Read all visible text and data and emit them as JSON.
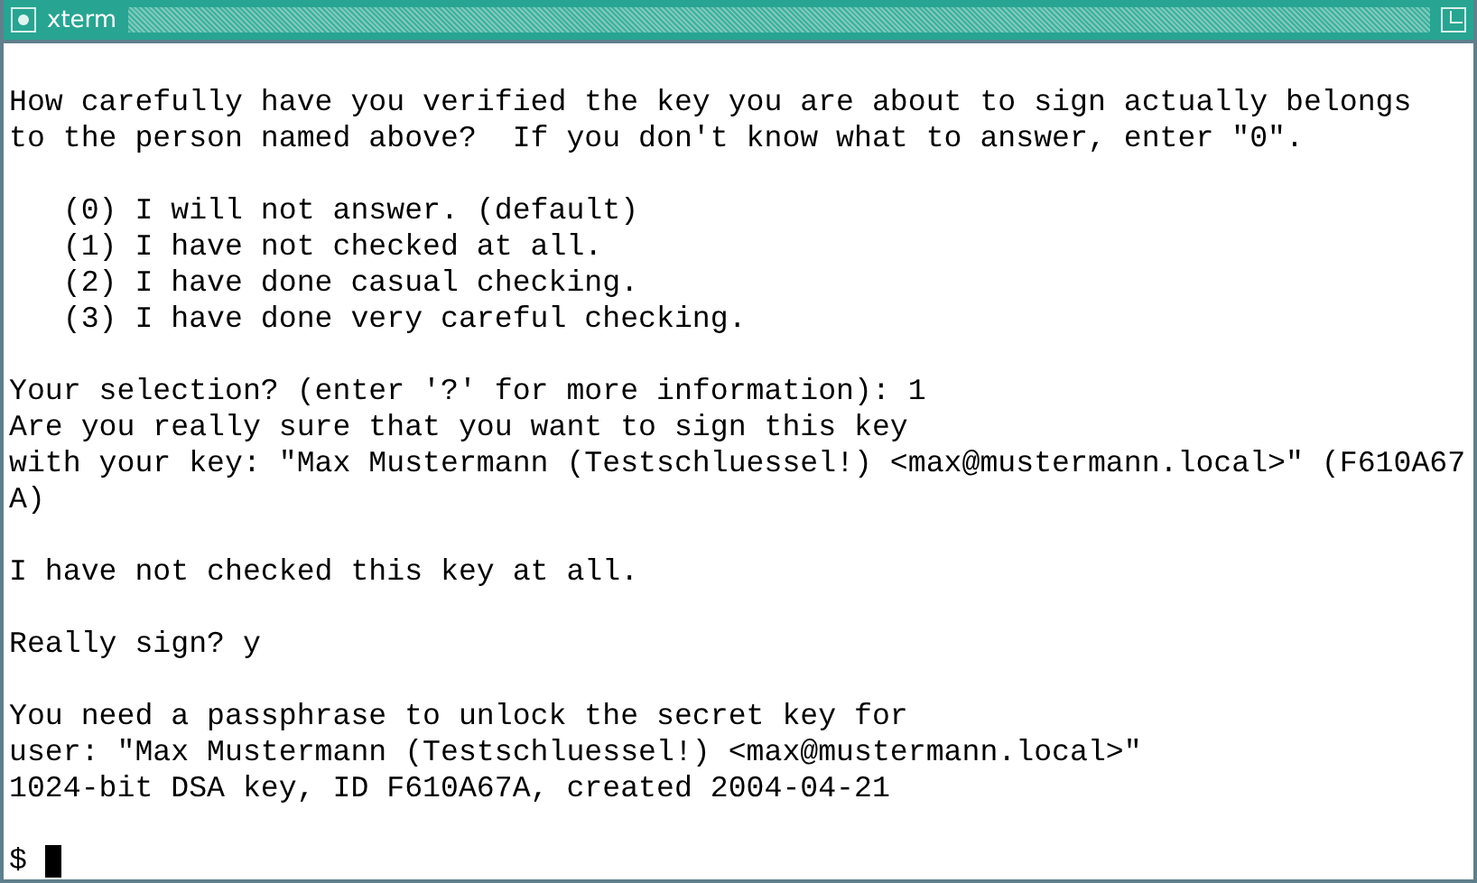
{
  "window": {
    "title": "xterm"
  },
  "terminal": {
    "blocks": [
      [
        "How carefully have you verified the key you are about to sign actually belongs",
        "to the person named above?  If you don't know what to answer, enter \"0\"."
      ],
      [
        "   (0) I will not answer. (default)",
        "   (1) I have not checked at all.",
        "   (2) I have done casual checking.",
        "   (3) I have done very careful checking."
      ],
      [
        "Your selection? (enter '?' for more information): 1",
        "Are you really sure that you want to sign this key",
        "with your key: \"Max Mustermann (Testschluessel!) <max@mustermann.local>\" (F610A67",
        "A)"
      ],
      [
        "I have not checked this key at all."
      ],
      [
        "Really sign? y"
      ],
      [
        "You need a passphrase to unlock the secret key for",
        "user: \"Max Mustermann (Testschluessel!) <max@mustermann.local>\"",
        "1024-bit DSA key, ID F610A67A, created 2004-04-21"
      ]
    ],
    "prompt": "$"
  }
}
